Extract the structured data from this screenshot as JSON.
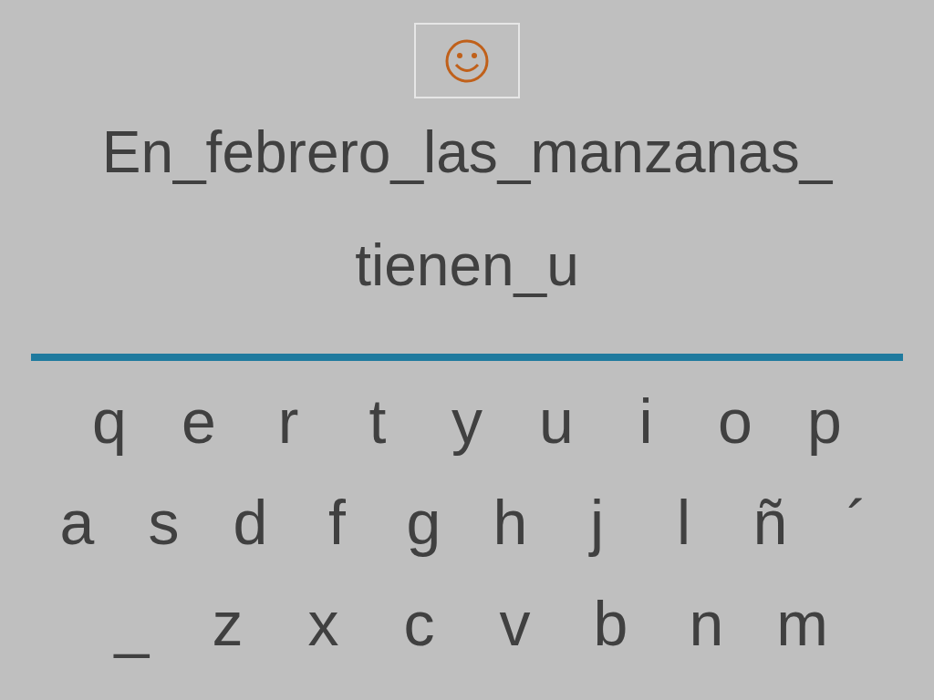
{
  "sentence_lines": [
    "En_febrero_las_manzanas_",
    "tienen_u"
  ],
  "keyboard_rows": [
    [
      "q",
      "e",
      "r",
      "t",
      "y",
      "u",
      "i",
      "o",
      "p"
    ],
    [
      "a",
      "s",
      "d",
      "f",
      "g",
      "h",
      "j",
      "l",
      "ñ",
      "´"
    ],
    [
      "_",
      "z",
      "x",
      "c",
      "v",
      "b",
      "n",
      "m"
    ]
  ]
}
